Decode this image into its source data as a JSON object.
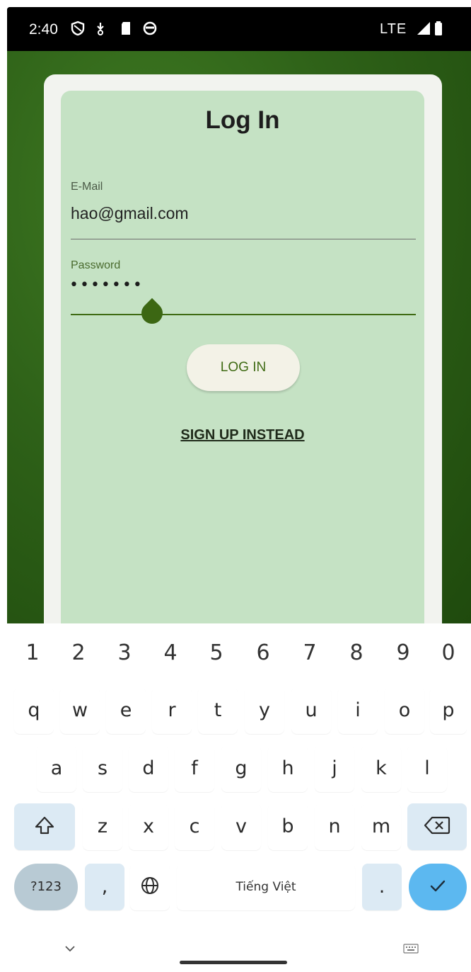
{
  "status_bar": {
    "time": "2:40",
    "network": "LTE",
    "icons": [
      "vpn-shield-icon",
      "download-icon",
      "sd-card-icon",
      "sync-icon",
      "signal-icon",
      "battery-icon"
    ]
  },
  "login": {
    "title": "Log In",
    "email_label": "E-Mail",
    "email_value": "hao@gmail.com",
    "password_label": "Password",
    "password_value": "•••••••",
    "login_button": "LOG IN",
    "signup_link": "SIGN UP INSTEAD"
  },
  "keyboard": {
    "numbers": [
      "1",
      "2",
      "3",
      "4",
      "5",
      "6",
      "7",
      "8",
      "9",
      "0"
    ],
    "row1": [
      "q",
      "w",
      "e",
      "r",
      "t",
      "y",
      "u",
      "i",
      "o",
      "p"
    ],
    "row2": [
      "a",
      "s",
      "d",
      "f",
      "g",
      "h",
      "j",
      "k",
      "l"
    ],
    "row3": [
      "z",
      "x",
      "c",
      "v",
      "b",
      "n",
      "m"
    ],
    "symbols_key": "?123",
    "comma_key": ",",
    "space_label": "Tiếng Việt",
    "period_key": ".",
    "enter_icon": "checkmark-icon",
    "shift_icon": "shift-icon",
    "backspace_icon": "backspace-icon",
    "language_icon": "globe-icon",
    "hide_icon": "chevron-down-icon",
    "switch_icon": "keyboard-icon"
  },
  "colors": {
    "app_background": "#2e6118",
    "card_background": "#c5e2c4",
    "accent": "#3f6b14",
    "enter_key": "#5cb8f0"
  }
}
